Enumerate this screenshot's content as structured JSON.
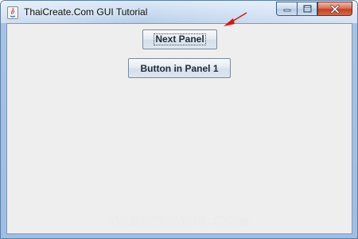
{
  "window": {
    "title": "ThaiCreate.Com GUI Tutorial",
    "controls": {
      "minimize": "minimize",
      "maximize": "maximize",
      "close": "close"
    }
  },
  "panel": {
    "buttons": {
      "next_panel": "Next Panel",
      "button_in_panel_1": "Button in Panel 1"
    }
  },
  "watermark": "THAICREATE.COM",
  "annotation": {
    "arrow_color": "#e01010"
  },
  "colors": {
    "client_background": "#eeeeee",
    "close_button": "#c5401f",
    "titlebar": "#b9d0ea"
  }
}
